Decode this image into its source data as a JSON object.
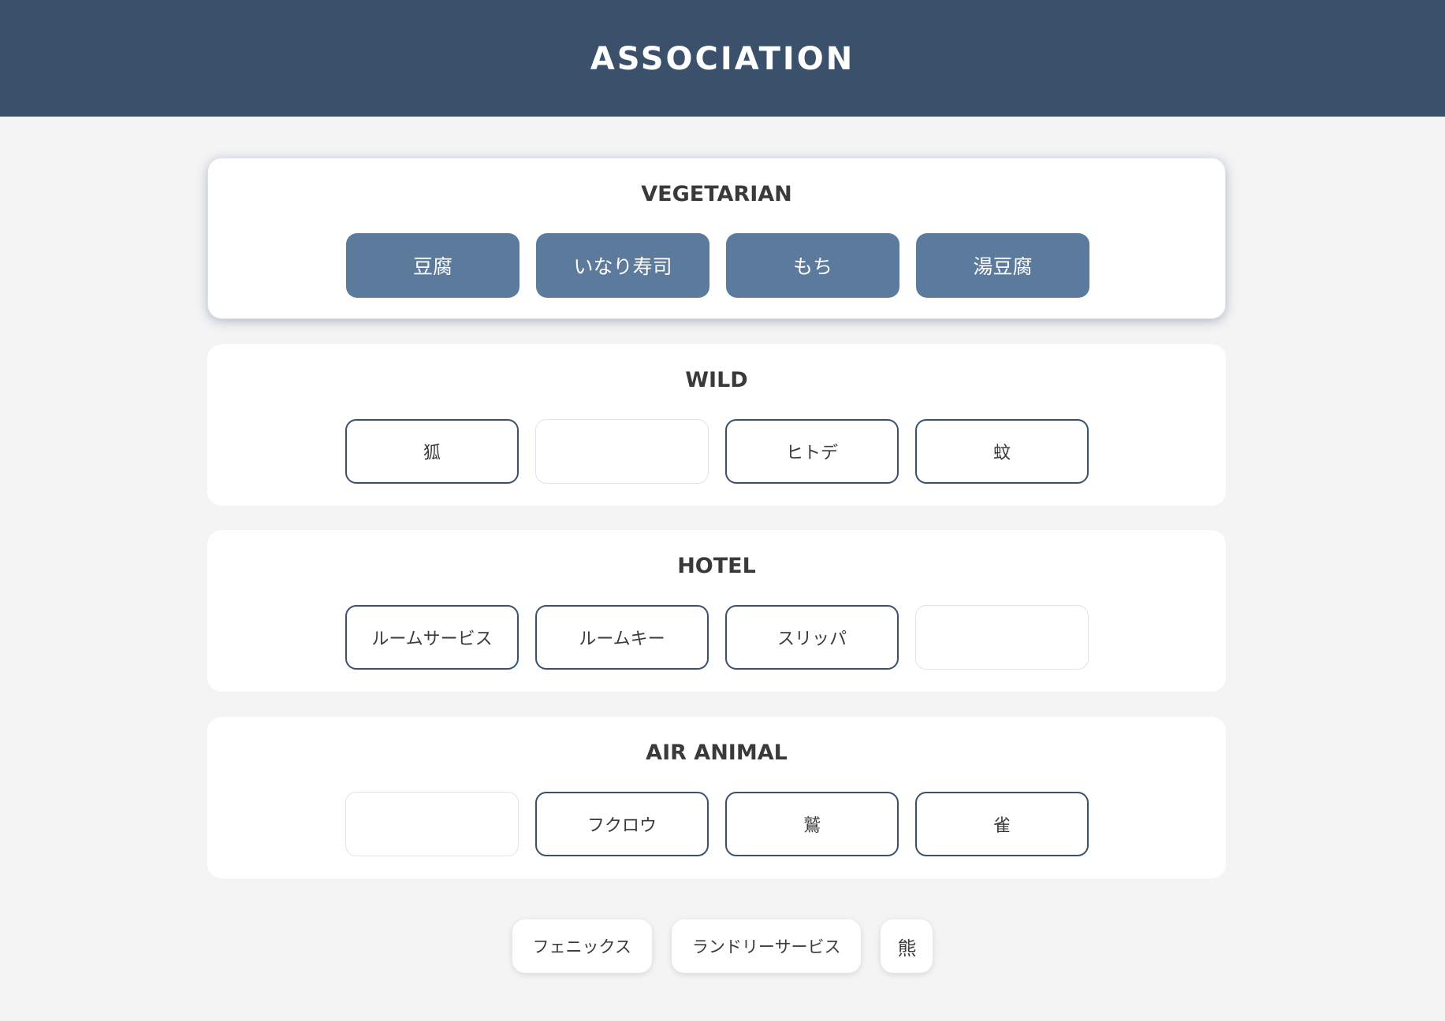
{
  "title": "ASSOCIATION",
  "groups": [
    {
      "name": "VEGETARIAN",
      "solved": true,
      "slots": [
        "豆腐",
        "いなり寿司",
        "もち",
        "湯豆腐"
      ]
    },
    {
      "name": "WILD",
      "solved": false,
      "slots": [
        "狐",
        "",
        "ヒトデ",
        "蚊"
      ]
    },
    {
      "name": "HOTEL",
      "solved": false,
      "slots": [
        "ルームサービス",
        "ルームキー",
        "スリッパ",
        ""
      ]
    },
    {
      "name": "AIR ANIMAL",
      "solved": false,
      "slots": [
        "",
        "フクロウ",
        "鷲",
        "雀"
      ]
    }
  ],
  "pool": [
    "フェニックス",
    "ランドリーサービス",
    "熊"
  ],
  "colors": {
    "header": "#3a506b",
    "background": "#f4f4f4",
    "solved_tile": "#5b7a9c",
    "tile_border": "#3a506b"
  }
}
